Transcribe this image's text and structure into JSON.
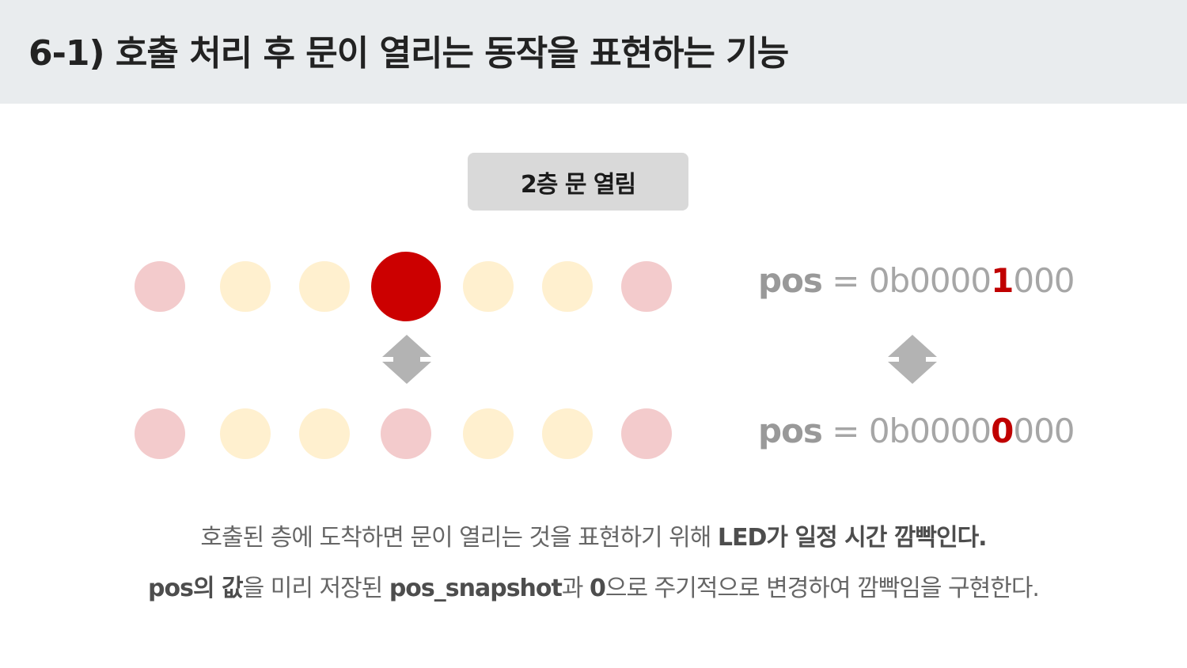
{
  "header": {
    "title": "6-1) 호출 처리 후 문이 열리는 동작을 표현하는 기능"
  },
  "badge": {
    "label": "2층 문 열림"
  },
  "colors": {
    "outer_led": "#f3cbcc",
    "inner_led": "#fff0cf",
    "active_led": "#cc0000",
    "highlight_bit": "#c00000",
    "arrow": "#b3b3b3"
  },
  "led_rows": [
    {
      "states": [
        "outer",
        "inner",
        "inner",
        "active",
        "inner",
        "inner",
        "outer"
      ]
    },
    {
      "states": [
        "outer",
        "inner",
        "inner",
        "outer",
        "inner",
        "inner",
        "outer"
      ]
    }
  ],
  "pos_rows": [
    {
      "name": "pos",
      "eq": " = ",
      "prefix": "0b0000",
      "bit": "1",
      "suffix": "000"
    },
    {
      "name": "pos",
      "eq": " = ",
      "prefix": "0b0000",
      "bit": "0",
      "suffix": "000"
    }
  ],
  "description": {
    "line1": {
      "plain": "호출된 층에 도착하면 문이 열리는 것을 표현하기 위해 ",
      "bold": "LED가 일정 시간 깜빡인다."
    },
    "line2": {
      "b1": "pos의 값",
      "t1": "을 미리 저장된 ",
      "b2": "pos_snapshot",
      "t2": "과 ",
      "b3": "0",
      "t3": "으로 주기적으로 변경하여 깜빡임을 구현한다."
    }
  }
}
